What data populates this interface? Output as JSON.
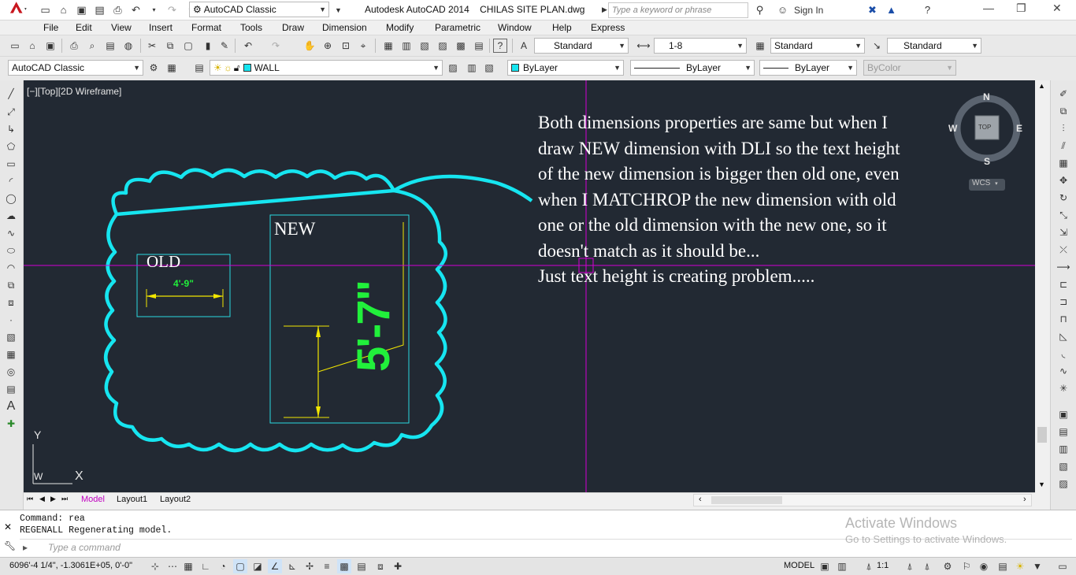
{
  "window": {
    "title": "Autodesk AutoCAD 2014    CHILAS SITE PLAN.dwg",
    "workspace": "AutoCAD Classic",
    "search_placeholder": "Type a keyword or phrase",
    "sign_in": "Sign In"
  },
  "menu": [
    "File",
    "Edit",
    "View",
    "Insert",
    "Format",
    "Tools",
    "Draw",
    "Dimension",
    "Modify",
    "Parametric",
    "Window",
    "Help",
    "Express"
  ],
  "styles_toolbar": {
    "text_style": "Standard",
    "dim_style": "1-8",
    "table_style": "Standard",
    "mleader_style": "Standard"
  },
  "layers_toolbar": {
    "workspace": "AutoCAD Classic",
    "layer": "WALL",
    "color": "ByLayer",
    "linetype": "ByLayer",
    "lineweight": "ByLayer",
    "plotstyle": "ByColor"
  },
  "viewport": {
    "label": "[−][Top][2D Wireframe]",
    "note_lines": [
      "Both dimensions properties are same but when I",
      "draw NEW dimension with DLI so the text height",
      "of the new dimension is bigger then old one, even",
      "when I MATCHROP the new dimension with old",
      "one or the old dimension with the new one, so it",
      "doesn't match as it should be...",
      "Just text height is creating problem....."
    ],
    "old_label": "OLD",
    "old_dim": "4'-9\"",
    "new_label": "NEW",
    "new_dim": "5'-7\"",
    "viewcube": {
      "north": "N",
      "south": "S",
      "east": "E",
      "west": "W",
      "face": "TOP",
      "ucs": "WCS"
    },
    "ucs_axes": {
      "x": "X",
      "y": "Y",
      "w": "W"
    }
  },
  "tabs": [
    "Model",
    "Layout1",
    "Layout2"
  ],
  "command": {
    "history": [
      "Command: rea",
      "REGENALL Regenerating model."
    ],
    "placeholder": "Type a command"
  },
  "activation": {
    "title": "Activate Windows",
    "subtitle": "Go to Settings to activate Windows."
  },
  "status": {
    "coords": "6096'-4 1/4\", -1.3061E+05, 0'-0\"",
    "model": "MODEL",
    "scale": "1:1"
  },
  "colors": {
    "canvas": "#222933",
    "cloud": "#16e5f0",
    "dimension": "#f2e600",
    "dimension_text": "#21f03b",
    "crosshair": "#d400d4",
    "box": "#2bd9e0"
  }
}
